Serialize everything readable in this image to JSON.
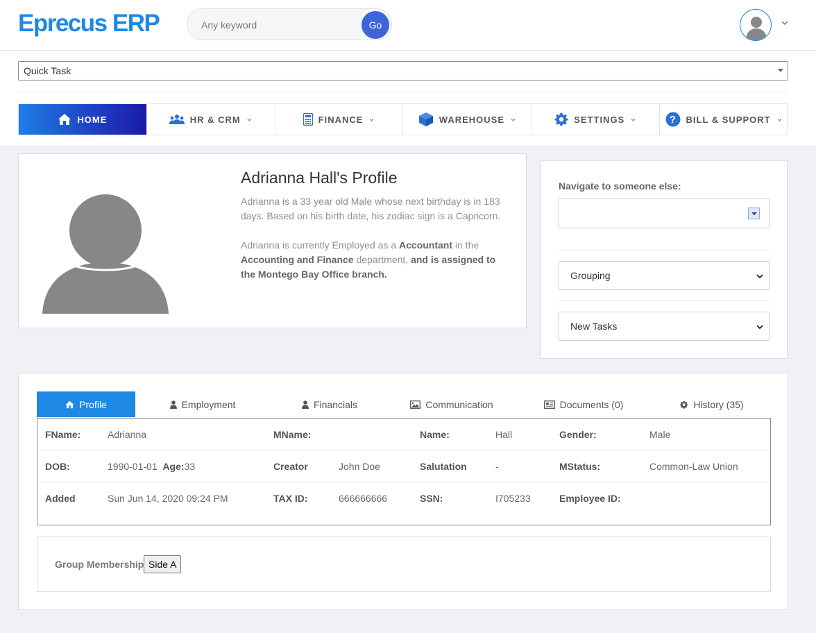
{
  "app": {
    "title": "Eprecus ERP"
  },
  "search": {
    "placeholder": "Any keyword",
    "button_label": "Go"
  },
  "quick_task": {
    "selected": "Quick Task"
  },
  "nav": {
    "items": [
      {
        "label": "HOME",
        "icon": "home-icon",
        "active": true
      },
      {
        "label": "HR & CRM",
        "icon": "users-icon"
      },
      {
        "label": "FINANCE",
        "icon": "calculator-icon"
      },
      {
        "label": "WAREHOUSE",
        "icon": "cube-icon"
      },
      {
        "label": "SETTINGS",
        "icon": "gear-icon"
      },
      {
        "label": "BILL & SUPPORT",
        "icon": "help-icon"
      }
    ]
  },
  "profile": {
    "title": "Adrianna Hall's Profile",
    "bio_1": "Adrianna is a 33 year old Male whose next birthday is in 183 days. Based on his birth date, his zodiac sign is a Capricorn.",
    "bio_2_pre": "Adrianna is currently Employed as a ",
    "bio_2_role": "Accountant",
    "bio_2_mid": " in the ",
    "bio_2_dept": "Accounting and Finance",
    "bio_2_mid2": " department, ",
    "bio_2_branch": "and is assigned to the Montego Bay Office branch."
  },
  "side_panel": {
    "navigate_label": "Navigate to someone else:",
    "navigate_value": "",
    "grouping": "Grouping",
    "tasks": "New Tasks"
  },
  "tabs": [
    {
      "label": "Profile",
      "icon": "home-icon",
      "active": true
    },
    {
      "label": "Employment",
      "icon": "user-icon"
    },
    {
      "label": "Financials",
      "icon": "user-icon"
    },
    {
      "label": "Communication",
      "icon": "image-icon"
    },
    {
      "label": "Documents (0)",
      "icon": "newspaper-icon"
    },
    {
      "label": "History (35)",
      "icon": "gear-icon"
    }
  ],
  "details": {
    "fname_label": "FName:",
    "fname": "Adrianna",
    "mname_label": "MName:",
    "mname": "",
    "name_label": "Name:",
    "name": "Hall",
    "gender_label": "Gender:",
    "gender": "Male",
    "dob_label": "DOB:",
    "dob": "1990-01-01",
    "age_label": "Age:",
    "age": "33",
    "creator_label": "Creator",
    "creator": "John Doe",
    "salutation_label": "Salutation",
    "salutation": "-",
    "mstatus_label": "MStatus:",
    "mstatus": "Common-Law Union",
    "added_label": "Added",
    "added": "Sun Jun 14, 2020 09:24 PM",
    "taxid_label": "TAX ID:",
    "taxid": "666666666",
    "ssn_label": "SSN:",
    "ssn": "I705233",
    "employee_id_label": "Employee ID:",
    "employee_id": ""
  },
  "group": {
    "label": "Group Membership:",
    "value": "Side A"
  }
}
